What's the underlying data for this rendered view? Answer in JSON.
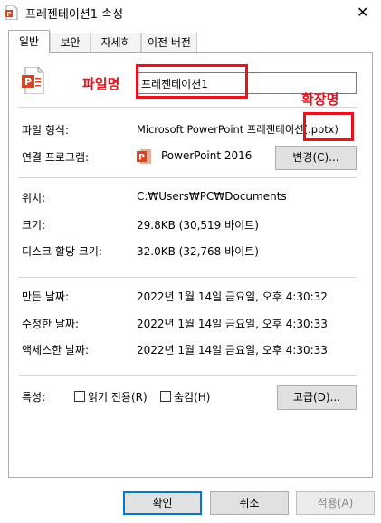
{
  "window": {
    "title": "프레젠테이션1 속성",
    "close_icon": "close-icon"
  },
  "tabs": [
    {
      "label": "일반",
      "active": true
    },
    {
      "label": "보안",
      "active": false
    },
    {
      "label": "자세히",
      "active": false
    },
    {
      "label": "이전 버전",
      "active": false
    }
  ],
  "general": {
    "file_name": "프레젠테이션1",
    "file_type_label": "파일 형식:",
    "file_type_value": "Microsoft PowerPoint 프레젠테이션(.pptx)",
    "open_with_label": "연결 프로그램:",
    "open_with_value": "PowerPoint 2016",
    "change_button": "변경(C)...",
    "location_label": "위치:",
    "location_value": "C:₩Users₩PC₩Documents",
    "size_label": "크기:",
    "size_value": "29.8KB (30,519 바이트)",
    "disk_size_label": "디스크 할당 크기:",
    "disk_size_value": "32.0KB (32,768 바이트)",
    "created_label": "만든 날짜:",
    "created_value": "2022년 1월 14일 금요일, 오후 4:30:32",
    "modified_label": "수정한 날짜:",
    "modified_value": "2022년 1월 14일 금요일, 오후 4:30:33",
    "accessed_label": "액세스한 날짜:",
    "accessed_value": "2022년 1월 14일 금요일, 오후 4:30:33",
    "attributes_label": "특성:",
    "readonly_label": "읽기 전용(R)",
    "readonly_checked": false,
    "hidden_label": "숨김(H)",
    "hidden_checked": false,
    "advanced_button": "고급(D)..."
  },
  "annotations": {
    "file_name_label": "파일명",
    "extension_label": "확장명",
    "color": "#e8121c"
  },
  "footer": {
    "ok_button": "확인",
    "cancel_button": "취소",
    "apply_button": "적용(A)",
    "apply_disabled": true
  },
  "colors": {
    "accent": "#0078d7",
    "powerpoint": "#d24726"
  }
}
